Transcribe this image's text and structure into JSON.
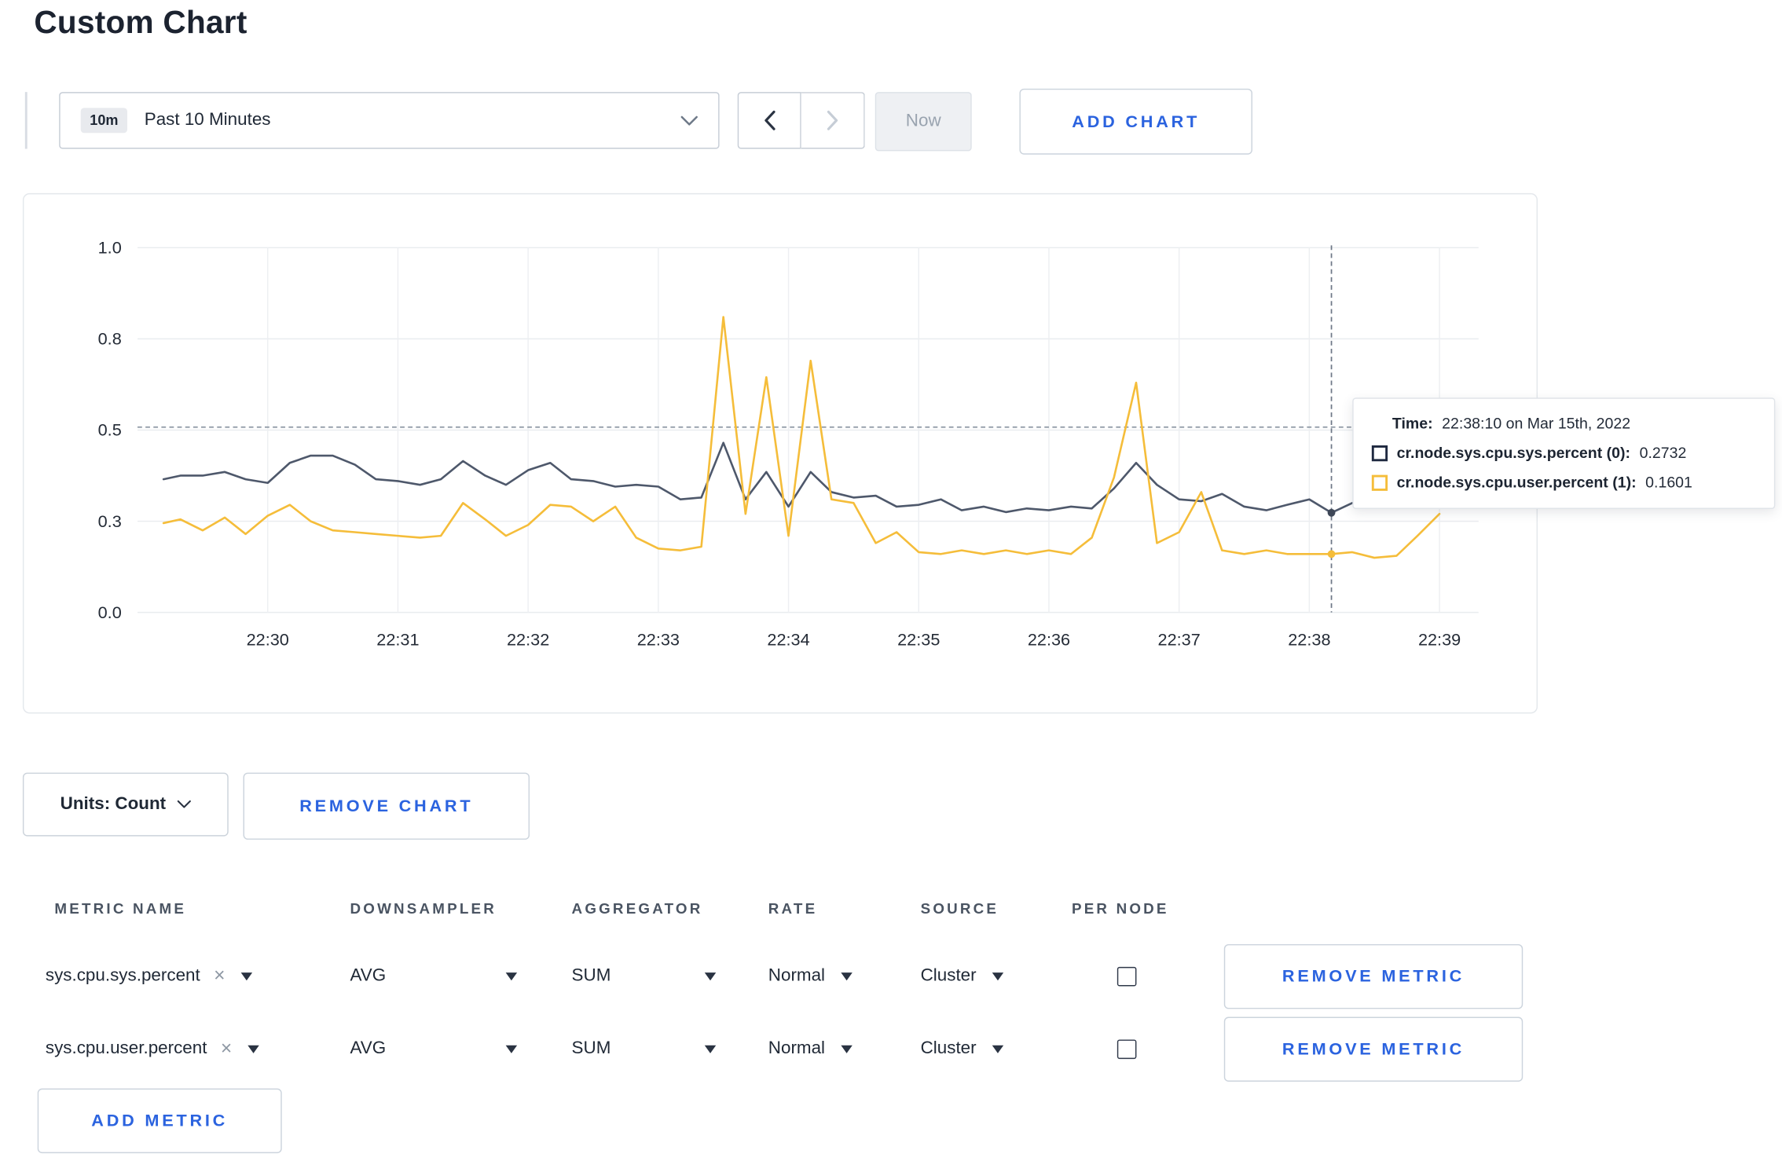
{
  "colors": {
    "accent_blue": "#2b63df",
    "series_sys_line": "#4e586b",
    "series_user_line": "#f5bd3a",
    "swatch_sys": "#1f2940",
    "swatch_user": "#f5bd3a"
  },
  "page": {
    "title": "Custom Chart"
  },
  "toolbar": {
    "time_range": {
      "badge": "10m",
      "label": "Past 10 Minutes"
    },
    "now_label": "Now",
    "add_chart_label": "ADD CHART"
  },
  "chart_data": {
    "type": "line",
    "title": "",
    "xlabel": "",
    "ylabel": "",
    "grid": true,
    "legend_position": "tooltip",
    "x_domain_minutes_after_2229": [
      0,
      10.3
    ],
    "ylim": [
      0,
      1
    ],
    "yticks": [
      {
        "v": 0.0,
        "label": "0.0"
      },
      {
        "v": 0.25,
        "label": "0.3"
      },
      {
        "v": 0.5,
        "label": "0.5"
      },
      {
        "v": 0.75,
        "label": "0.8"
      },
      {
        "v": 1.0,
        "label": "1.0"
      }
    ],
    "xticks": [
      {
        "t": 1,
        "label": "22:30"
      },
      {
        "t": 2,
        "label": "22:31"
      },
      {
        "t": 3,
        "label": "22:32"
      },
      {
        "t": 4,
        "label": "22:33"
      },
      {
        "t": 5,
        "label": "22:34"
      },
      {
        "t": 6,
        "label": "22:35"
      },
      {
        "t": 7,
        "label": "22:36"
      },
      {
        "t": 8,
        "label": "22:37"
      },
      {
        "t": 9,
        "label": "22:38"
      },
      {
        "t": 10,
        "label": "22:39"
      }
    ],
    "crosshair": {
      "t": 9.17,
      "value": 0.508
    },
    "hover_points": [
      {
        "t": 9.17,
        "v": 0.2732,
        "color": "#3e4757"
      },
      {
        "t": 9.17,
        "v": 0.1601,
        "color": "#f5bd3a"
      }
    ],
    "series": [
      {
        "name": "cr.node.sys.cpu.sys.percent",
        "color": "#4e586b",
        "points": [
          [
            0.2,
            0.365
          ],
          [
            0.33,
            0.375
          ],
          [
            0.5,
            0.375
          ],
          [
            0.67,
            0.385
          ],
          [
            0.83,
            0.365
          ],
          [
            1.0,
            0.355
          ],
          [
            1.17,
            0.41
          ],
          [
            1.33,
            0.43
          ],
          [
            1.5,
            0.43
          ],
          [
            1.67,
            0.405
          ],
          [
            1.83,
            0.365
          ],
          [
            2.0,
            0.36
          ],
          [
            2.17,
            0.35
          ],
          [
            2.33,
            0.365
          ],
          [
            2.5,
            0.415
          ],
          [
            2.67,
            0.375
          ],
          [
            2.83,
            0.35
          ],
          [
            3.0,
            0.39
          ],
          [
            3.17,
            0.41
          ],
          [
            3.33,
            0.365
          ],
          [
            3.5,
            0.36
          ],
          [
            3.67,
            0.345
          ],
          [
            3.83,
            0.35
          ],
          [
            4.0,
            0.345
          ],
          [
            4.17,
            0.31
          ],
          [
            4.33,
            0.315
          ],
          [
            4.5,
            0.465
          ],
          [
            4.67,
            0.31
          ],
          [
            4.83,
            0.385
          ],
          [
            5.0,
            0.29
          ],
          [
            5.17,
            0.385
          ],
          [
            5.33,
            0.33
          ],
          [
            5.5,
            0.315
          ],
          [
            5.67,
            0.32
          ],
          [
            5.83,
            0.29
          ],
          [
            6.0,
            0.295
          ],
          [
            6.17,
            0.31
          ],
          [
            6.33,
            0.28
          ],
          [
            6.5,
            0.29
          ],
          [
            6.67,
            0.275
          ],
          [
            6.83,
            0.285
          ],
          [
            7.0,
            0.28
          ],
          [
            7.17,
            0.29
          ],
          [
            7.33,
            0.285
          ],
          [
            7.5,
            0.34
          ],
          [
            7.67,
            0.41
          ],
          [
            7.83,
            0.35
          ],
          [
            8.0,
            0.31
          ],
          [
            8.17,
            0.305
          ],
          [
            8.33,
            0.325
          ],
          [
            8.5,
            0.29
          ],
          [
            8.67,
            0.28
          ],
          [
            8.83,
            0.295
          ],
          [
            9.0,
            0.31
          ],
          [
            9.17,
            0.2732
          ],
          [
            9.33,
            0.3
          ]
        ]
      },
      {
        "name": "cr.node.sys.cpu.user.percent",
        "color": "#f5bd3a",
        "points": [
          [
            0.2,
            0.245
          ],
          [
            0.33,
            0.255
          ],
          [
            0.5,
            0.225
          ],
          [
            0.67,
            0.26
          ],
          [
            0.83,
            0.215
          ],
          [
            1.0,
            0.265
          ],
          [
            1.17,
            0.295
          ],
          [
            1.33,
            0.25
          ],
          [
            1.5,
            0.225
          ],
          [
            1.67,
            0.22
          ],
          [
            1.83,
            0.215
          ],
          [
            2.0,
            0.21
          ],
          [
            2.17,
            0.205
          ],
          [
            2.33,
            0.21
          ],
          [
            2.5,
            0.3
          ],
          [
            2.67,
            0.255
          ],
          [
            2.83,
            0.21
          ],
          [
            3.0,
            0.24
          ],
          [
            3.17,
            0.295
          ],
          [
            3.33,
            0.29
          ],
          [
            3.5,
            0.25
          ],
          [
            3.67,
            0.29
          ],
          [
            3.83,
            0.205
          ],
          [
            4.0,
            0.175
          ],
          [
            4.17,
            0.17
          ],
          [
            4.33,
            0.18
          ],
          [
            4.5,
            0.81
          ],
          [
            4.67,
            0.27
          ],
          [
            4.83,
            0.645
          ],
          [
            5.0,
            0.21
          ],
          [
            5.17,
            0.69
          ],
          [
            5.33,
            0.31
          ],
          [
            5.5,
            0.3
          ],
          [
            5.67,
            0.19
          ],
          [
            5.83,
            0.22
          ],
          [
            6.0,
            0.165
          ],
          [
            6.17,
            0.16
          ],
          [
            6.33,
            0.17
          ],
          [
            6.5,
            0.16
          ],
          [
            6.67,
            0.17
          ],
          [
            6.83,
            0.16
          ],
          [
            7.0,
            0.17
          ],
          [
            7.17,
            0.16
          ],
          [
            7.33,
            0.205
          ],
          [
            7.5,
            0.37
          ],
          [
            7.67,
            0.63
          ],
          [
            7.83,
            0.19
          ],
          [
            8.0,
            0.22
          ],
          [
            8.17,
            0.33
          ],
          [
            8.33,
            0.17
          ],
          [
            8.5,
            0.16
          ],
          [
            8.67,
            0.17
          ],
          [
            8.83,
            0.16
          ],
          [
            9.0,
            0.16
          ],
          [
            9.17,
            0.1601
          ],
          [
            9.33,
            0.165
          ],
          [
            9.5,
            0.15
          ],
          [
            9.67,
            0.155
          ],
          [
            9.83,
            0.21
          ],
          [
            10.0,
            0.27
          ]
        ]
      }
    ]
  },
  "tooltip": {
    "time_label": "Time:",
    "time_value": "22:38:10 on Mar 15th, 2022",
    "rows": [
      {
        "name": "cr.node.sys.cpu.sys.percent (0):",
        "value": "0.2732",
        "color": "#1f2940"
      },
      {
        "name": "cr.node.sys.cpu.user.percent (1):",
        "value": "0.1601",
        "color": "#f5bd3a"
      }
    ]
  },
  "chart_footer": {
    "units_label": "Units: Count",
    "remove_chart_label": "REMOVE CHART"
  },
  "metrics_table": {
    "headers": [
      "METRIC NAME",
      "DOWNSAMPLER",
      "AGGREGATOR",
      "RATE",
      "SOURCE",
      "PER NODE"
    ],
    "remove_token": "×",
    "rows": [
      {
        "metric": "sys.cpu.sys.percent",
        "downsampler": "AVG",
        "aggregator": "SUM",
        "rate": "Normal",
        "source": "Cluster",
        "per_node_checked": false,
        "remove_label": "REMOVE METRIC"
      },
      {
        "metric": "sys.cpu.user.percent",
        "downsampler": "AVG",
        "aggregator": "SUM",
        "rate": "Normal",
        "source": "Cluster",
        "per_node_checked": false,
        "remove_label": "REMOVE METRIC"
      }
    ],
    "add_metric_label": "ADD METRIC"
  }
}
